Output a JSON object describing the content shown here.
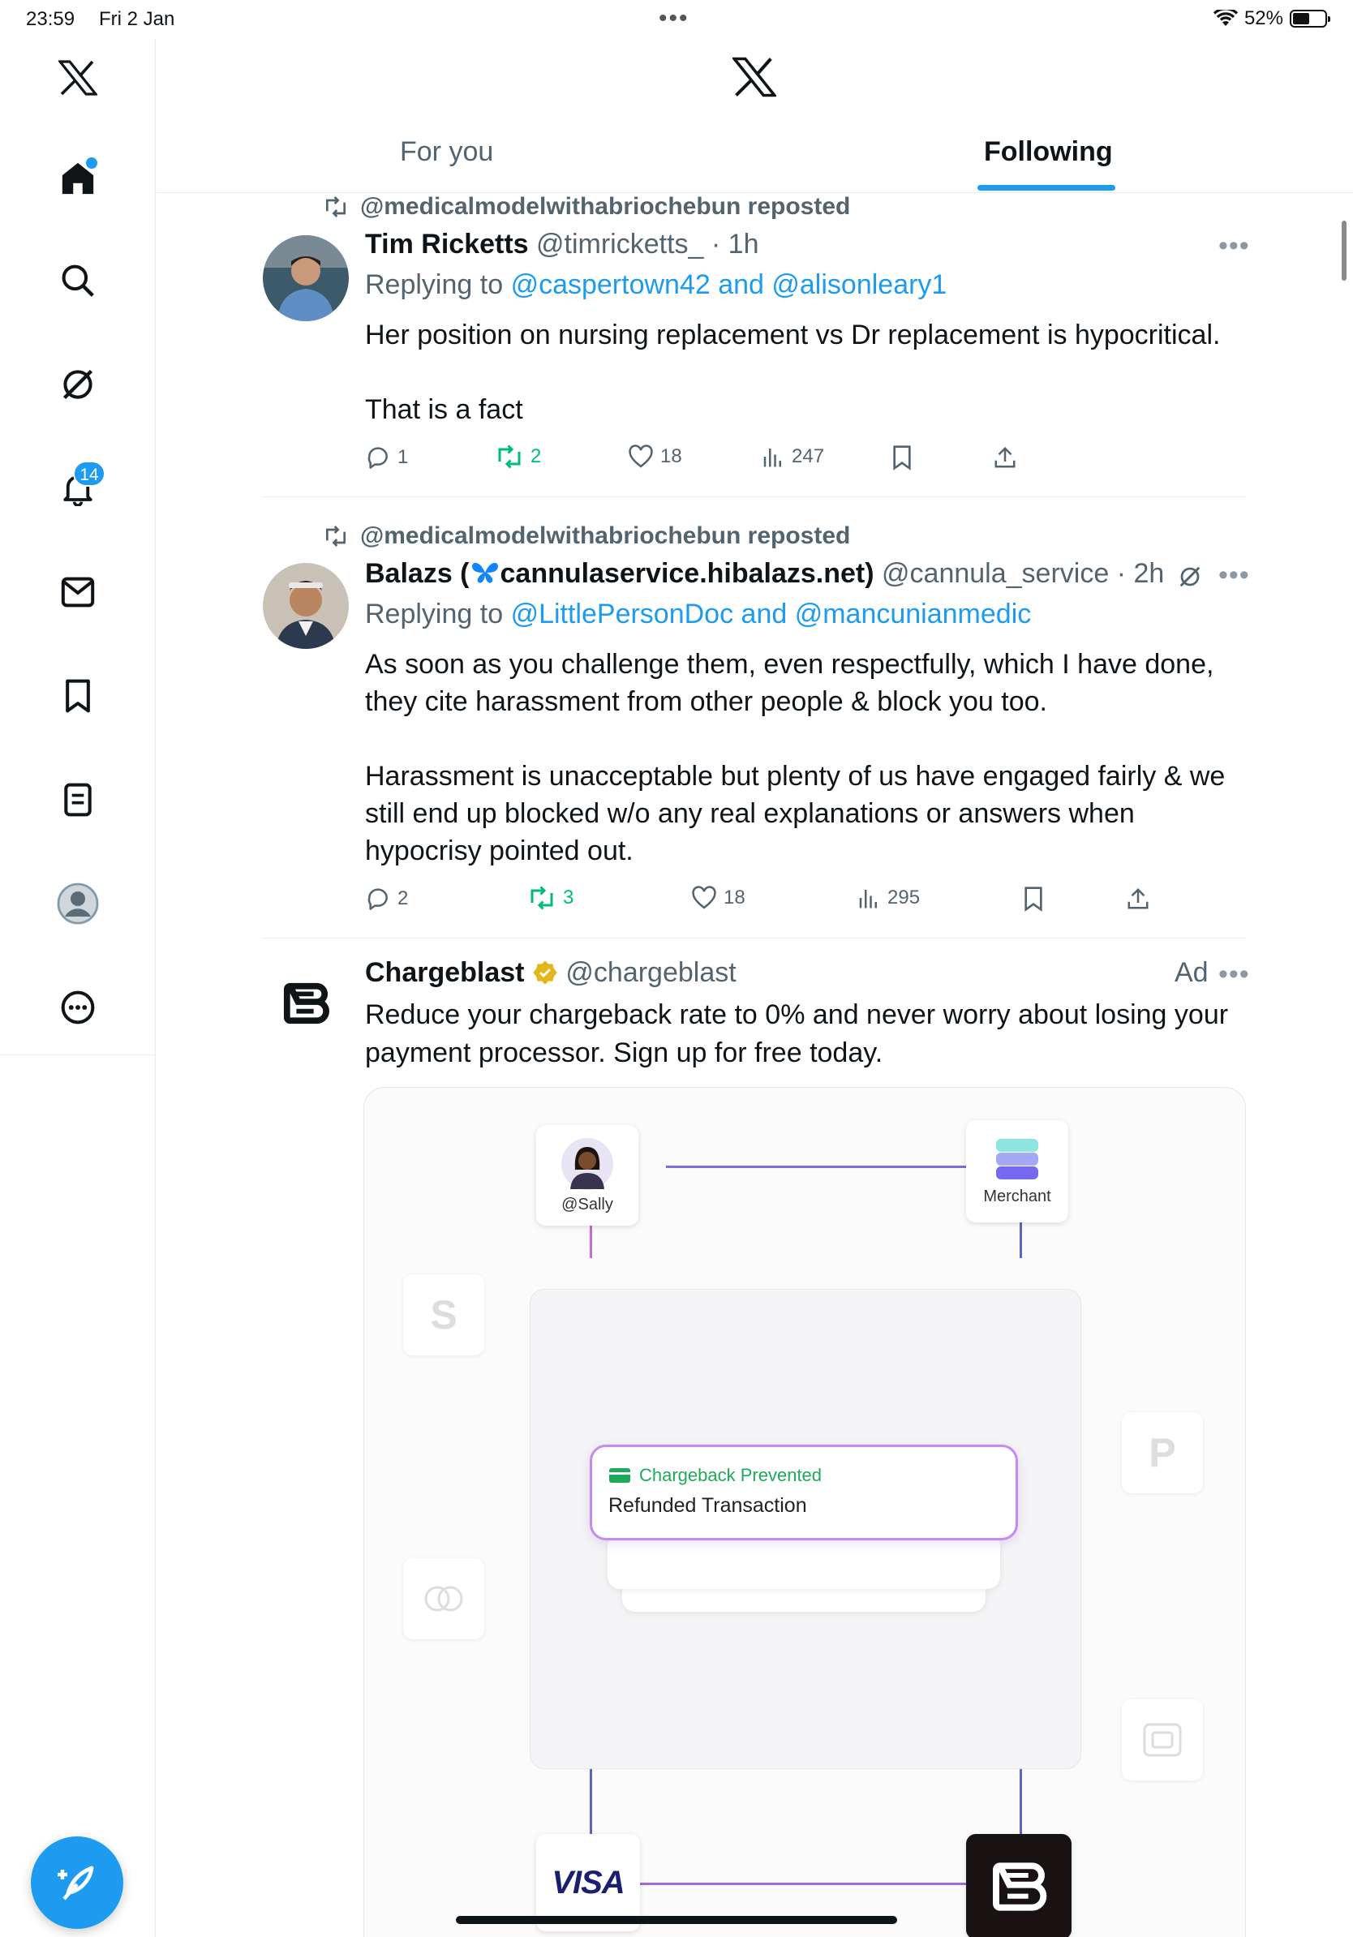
{
  "status_bar": {
    "time": "23:59",
    "date": "Fri 2 Jan",
    "battery": "52%",
    "battery_level": 0.52
  },
  "sidebar": {
    "notifications_badge": "14",
    "icons": [
      "x-logo-icon",
      "home-icon",
      "search-icon",
      "grok-icon",
      "notifications-icon",
      "messages-icon",
      "bookmarks-icon",
      "lists-icon",
      "profile-icon",
      "more-icon"
    ]
  },
  "header": {
    "tabs": [
      {
        "label": "For you",
        "active": false
      },
      {
        "label": "Following",
        "active": true
      }
    ]
  },
  "tweets": [
    {
      "reposted_by": "@medicalmodelwithabriochebun reposted",
      "name": "Tim Ricketts",
      "handle": "@timricketts_",
      "time": "1h",
      "replying_prefix": "Replying to",
      "replying_to": "@caspertown42 and @alisonleary1",
      "text": "Her position on nursing replacement vs Dr replacement is hypocritical.\n\nThat is a fact",
      "replies": "1",
      "reposts": "2",
      "likes": "18",
      "views": "247"
    },
    {
      "reposted_by": "@medicalmodelwithabriochebun reposted",
      "name_prefix": "Balazs (",
      "name_suffix": "cannulaservice.hibalazs.net)",
      "handle": "@cannula_service",
      "time": "2h",
      "replying_prefix": "Replying to",
      "replying_to": "@LittlePersonDoc and @mancunianmedic",
      "text": "As soon as you challenge them, even respectfully, which I have done, they cite harassment from other people & block you too.\n\nHarassment is unacceptable but plenty of us have engaged fairly & we still end up blocked w/o any real explanations or answers when hypocrisy pointed out.",
      "replies": "2",
      "reposts": "3",
      "likes": "18",
      "views": "295"
    }
  ],
  "ad": {
    "name": "Chargeblast",
    "handle": "@chargeblast",
    "ad_label": "Ad",
    "text": "Reduce your chargeback rate to 0% and never worry about losing your payment processor. Sign up for free today.",
    "card": {
      "user_label": "@Sally",
      "merchant_label": "Merchant",
      "notice_title": "Chargeback Prevented",
      "notice_body": "Refunded Transaction",
      "visa_label": "VISA"
    }
  },
  "colors": {
    "accent": "#1d9bf0",
    "repost_green": "#00ba7c",
    "muted": "#536471"
  }
}
